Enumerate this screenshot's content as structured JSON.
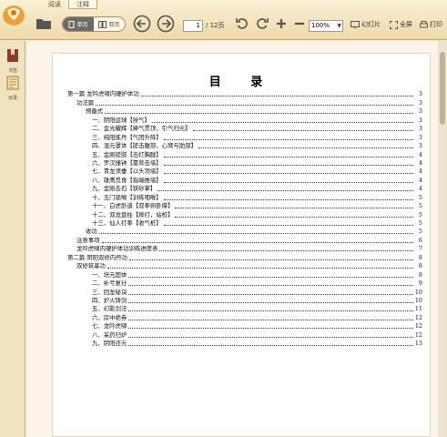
{
  "tabs": [
    {
      "label": "阅读",
      "active": false
    },
    {
      "label": "注释",
      "active": true
    }
  ],
  "toolbar": {
    "single_page_label": "单页",
    "double_page_label": "双页",
    "page_current": "1",
    "page_total": "/ 12页",
    "zoom_value": "100%",
    "slideshow_label": "幻灯片",
    "fullscreen_label": "全屏",
    "print_label": "打印"
  },
  "sidebar": {
    "items": [
      {
        "label": "书签",
        "icon": "bookmark-icon"
      },
      {
        "label": "目录",
        "icon": "contents-icon"
      }
    ]
  },
  "document": {
    "title": "目  录",
    "toc": [
      {
        "text": "第一篇  龙吟虎啸内硬护体功",
        "page": "3",
        "level": 0
      },
      {
        "text": "功法篇",
        "page": "3",
        "level": 1
      },
      {
        "text": "预备式",
        "page": "3",
        "level": 2
      },
      {
        "text": "一、阴阳运球【拴气】",
        "page": "3",
        "level": 3
      },
      {
        "text": "二、金光耀辉【捧气贯顶，引气归元】",
        "page": "3",
        "level": 3
      },
      {
        "text": "三、纯阳炼丹【气团升降】",
        "page": "3",
        "level": 3
      },
      {
        "text": "四、混元罩体【搓击腹部，心窝与肋部】",
        "page": "3",
        "level": 3
      },
      {
        "text": "五、金刚搓肢【击打胸膛】",
        "page": "4",
        "level": 3
      },
      {
        "text": "六、罗汉撞钟【靠背击墙】",
        "page": "4",
        "level": 3
      },
      {
        "text": "七、青龙须垂【以头顶墙】",
        "page": "4",
        "level": 3
      },
      {
        "text": "八、雄鹰觅食【指端推墙】",
        "page": "4",
        "level": 3
      },
      {
        "text": "九、金刚击石【铁砂掌】",
        "page": "4",
        "level": 3
      },
      {
        "text": "十、玉门锁喉【训练咽喉】",
        "page": "5",
        "level": 3
      },
      {
        "text": "十一、白虎卧道【双拳俯卧撑】",
        "page": "5",
        "level": 3
      },
      {
        "text": "十二、双龙盘柱【摔打，站桩】",
        "page": "5",
        "level": 3
      },
      {
        "text": "十三、仙人打拳【收气桩】",
        "page": "5",
        "level": 3
      },
      {
        "text": "收功",
        "page": "5",
        "level": 2
      },
      {
        "text": "注意事项",
        "page": "6",
        "level": 1
      },
      {
        "text": "龙吟虎啸内硬护体功训练进度表",
        "page": "7",
        "level": 1
      },
      {
        "text": "第二篇  阴阳双修内丹功",
        "page": "8",
        "level": 0
      },
      {
        "text": "双修筑基功",
        "page": "8",
        "level": 1
      },
      {
        "text": "一、培元固体",
        "page": "8",
        "level": 3
      },
      {
        "text": "二、补亏复壮",
        "page": "9",
        "level": 3
      },
      {
        "text": "三、回龙秘诀",
        "page": "10",
        "level": 3
      },
      {
        "text": "四、炉火铸剑",
        "page": "10",
        "level": 3
      },
      {
        "text": "五、幻影剑法",
        "page": "11",
        "level": 3
      },
      {
        "text": "六、房中绝券",
        "page": "12",
        "level": 3
      },
      {
        "text": "七、龙吟虎啸",
        "page": "12",
        "level": 3
      },
      {
        "text": "八、采药归炉",
        "page": "12",
        "level": 3
      },
      {
        "text": "九、阴阳还元",
        "page": "13",
        "level": 3
      }
    ]
  }
}
